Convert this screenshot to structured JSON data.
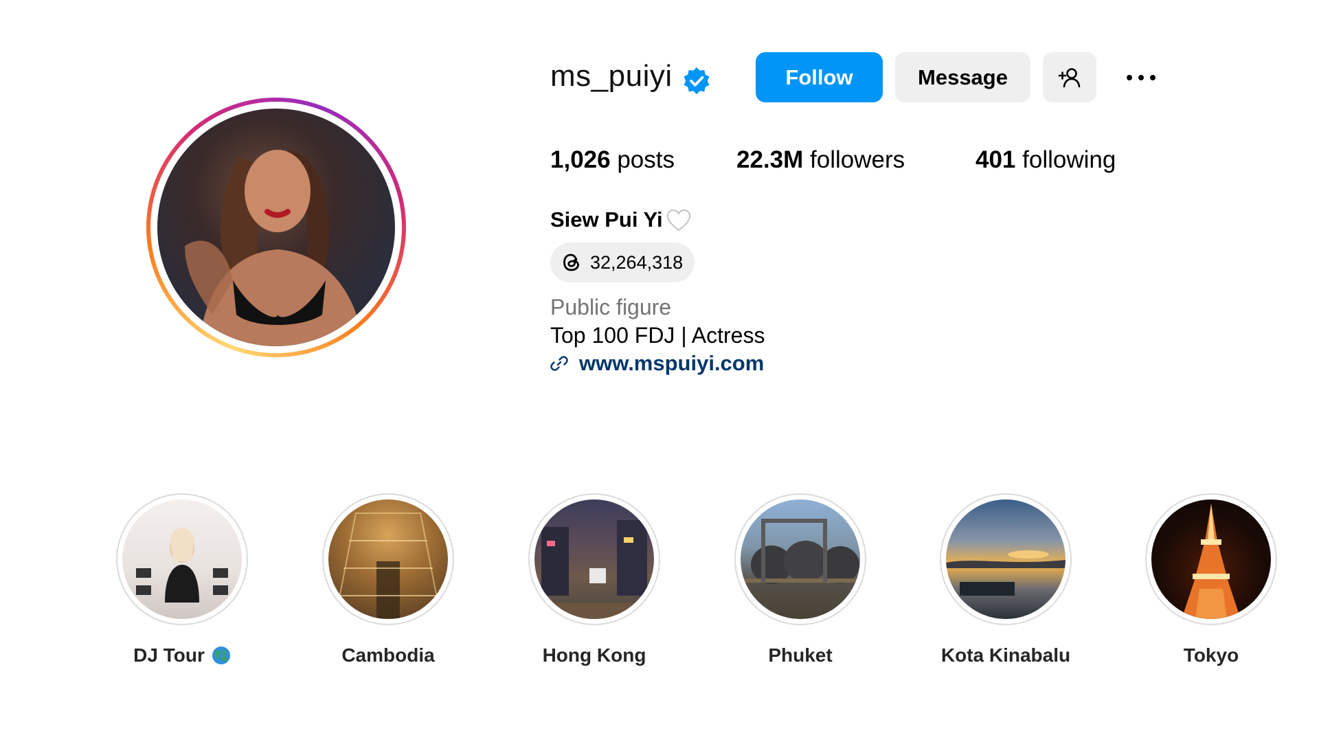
{
  "profile": {
    "username": "ms_puiyi",
    "verified": true,
    "full_name": "Siew Pui Yi",
    "threads_count": "32,264,318",
    "category": "Public figure",
    "bio": "Top 100 FDJ | Actress",
    "link": "www.mspuiyi.com"
  },
  "actions": {
    "follow_label": "Follow",
    "message_label": "Message",
    "suggest_icon": "add-person-icon",
    "more_icon": "more-options-icon"
  },
  "stats": {
    "posts_count": "1,026",
    "posts_label": "posts",
    "followers_count": "22.3M",
    "followers_label": "followers",
    "following_count": "401",
    "following_label": "following"
  },
  "highlights": [
    {
      "label": "DJ Tour"
    },
    {
      "label": "Cambodia"
    },
    {
      "label": "Hong Kong"
    },
    {
      "label": "Phuket"
    },
    {
      "label": "Kota Kinabalu"
    },
    {
      "label": "Tokyo"
    }
  ],
  "colors": {
    "primary_button": "#0095f6",
    "secondary_button": "#efefef",
    "link": "#00376b",
    "muted_text": "#737373",
    "verified_badge": "#0095f6",
    "avatar_ring_start": "#feda75",
    "avatar_ring_end": "#d62976"
  }
}
